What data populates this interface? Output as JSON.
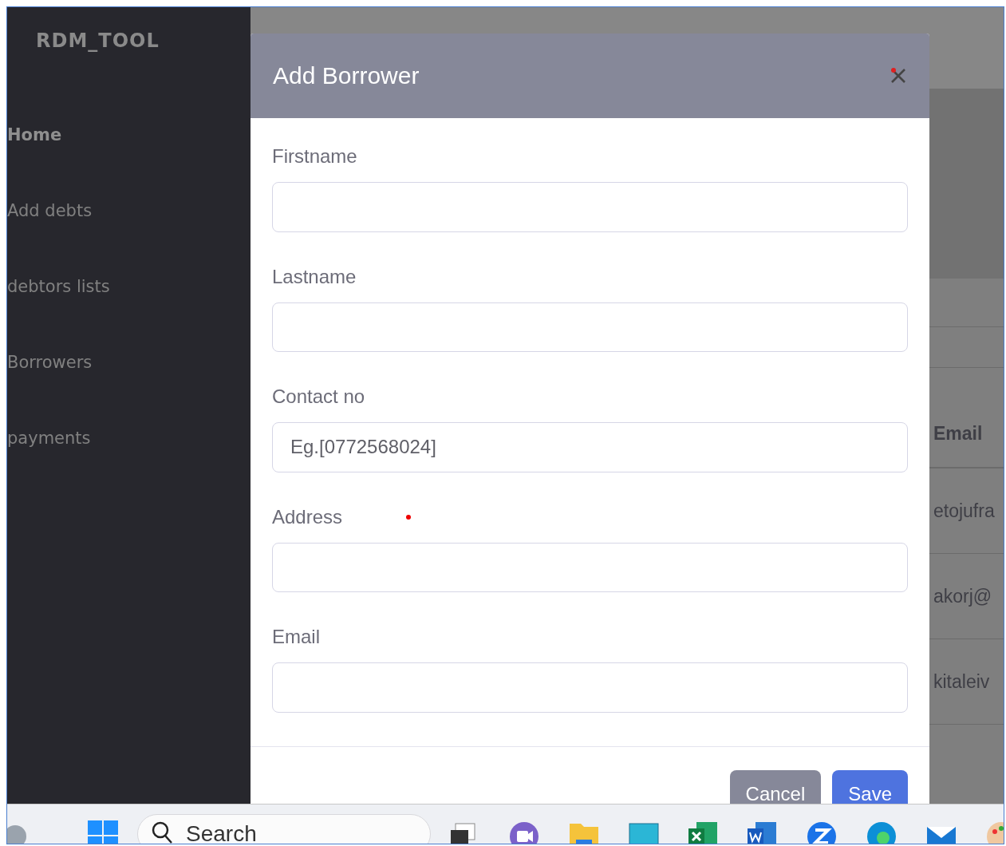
{
  "sidebar": {
    "brand": "RDM_TOOL",
    "items": [
      {
        "label": "Home",
        "selected": true
      },
      {
        "label": "Add debts",
        "selected": false
      },
      {
        "label": "debtors lists",
        "selected": false
      },
      {
        "label": "Borrowers",
        "selected": false
      },
      {
        "label": "payments",
        "selected": false
      }
    ]
  },
  "background_table": {
    "columns": [
      "Email"
    ],
    "rows": [
      "etojufra",
      "akorj@",
      "kitaleiv"
    ]
  },
  "modal": {
    "title": "Add Borrower",
    "fields": [
      {
        "label": "Firstname"
      },
      {
        "label": "Lastname"
      },
      {
        "label": "Contact no",
        "placeholder": "Eg.[0772568024]"
      },
      {
        "label": "Address",
        "marked": true
      },
      {
        "label": "Email"
      }
    ],
    "buttons": [
      {
        "label": "Cancel",
        "kind": "secondary"
      },
      {
        "label": "Save",
        "kind": "primary"
      }
    ]
  },
  "taskbar": {
    "search": {
      "placeholder": "Search"
    }
  }
}
